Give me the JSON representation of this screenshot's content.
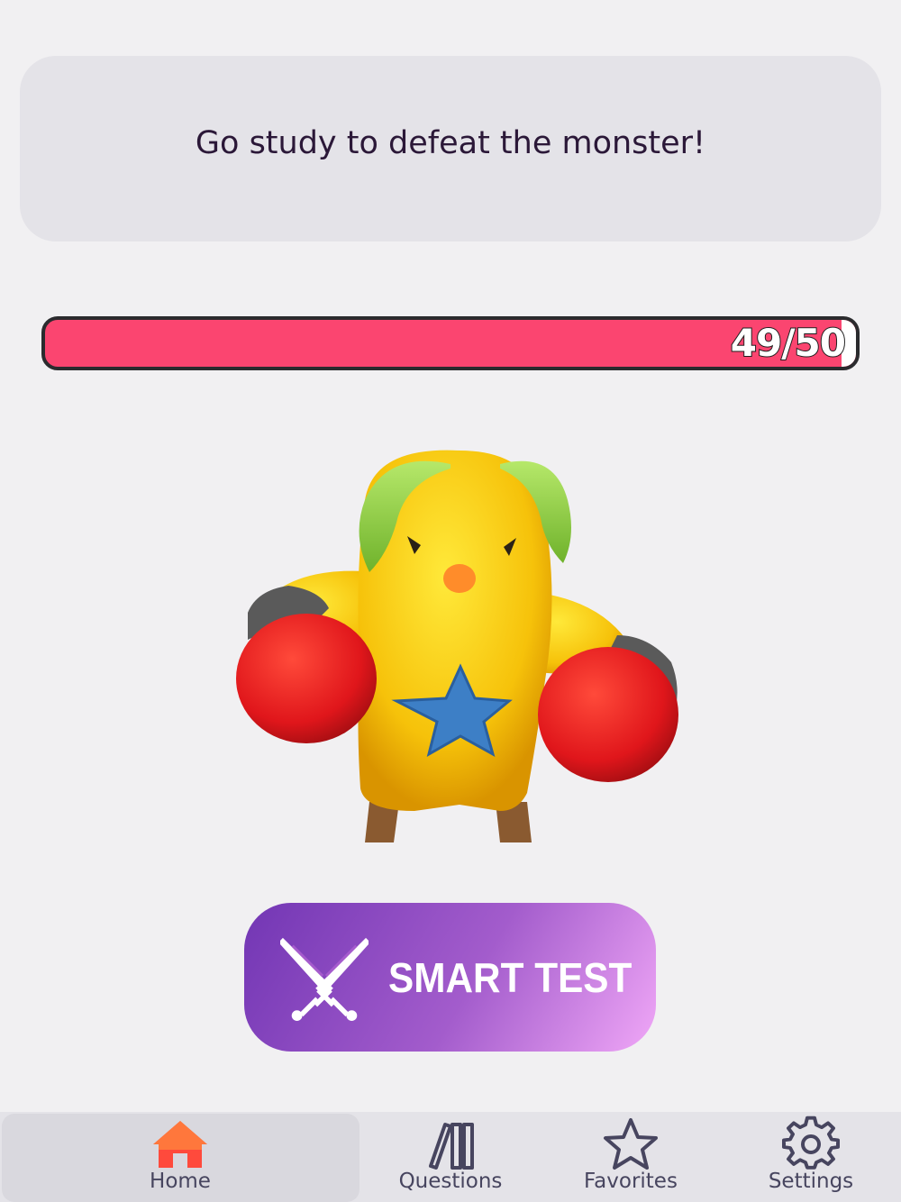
{
  "message": "Go study to defeat the monster!",
  "monster_hp": {
    "label": "49/50",
    "current": 49,
    "max": 50,
    "bar_color": "#fb4570"
  },
  "smart_test": {
    "label": "SMART TEST",
    "icon": "crossed-swords-icon"
  },
  "tabs": [
    {
      "label": "Home",
      "icon": "home-icon",
      "active": true
    },
    {
      "label": "Questions",
      "icon": "books-icon",
      "active": false
    },
    {
      "label": "Favorites",
      "icon": "star-icon",
      "active": false
    },
    {
      "label": "Settings",
      "icon": "gear-icon",
      "active": false
    }
  ],
  "colors": {
    "background": "#f1f0f2",
    "card": "#e4e3e8",
    "accent_gradient": [
      "#7236b4",
      "#f0a7f7"
    ],
    "home_icon": "#ff4a3c"
  }
}
